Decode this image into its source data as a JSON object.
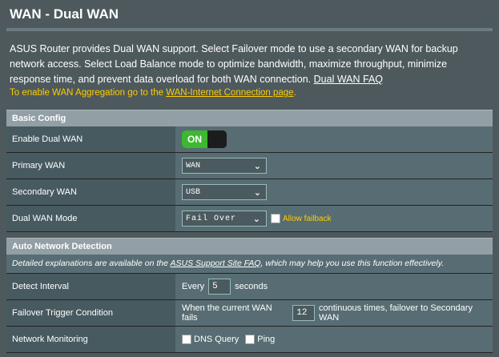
{
  "header": {
    "title": "WAN - Dual WAN",
    "description": "ASUS Router provides Dual WAN support. Select Failover mode to use a secondary WAN for backup network access. Select Load Balance mode to optimize bandwidth, maximize throughput, minimize response time, and prevent data overload for both WAN connection.",
    "faq_link": "Dual WAN FAQ",
    "aggregation_prefix": "To enable WAN Aggregation go to the ",
    "aggregation_link": "WAN-Internet Connection page",
    "aggregation_suffix": "."
  },
  "basic_config": {
    "heading": "Basic Config",
    "enable_label": "Enable Dual WAN",
    "enable_value": "ON",
    "primary_label": "Primary WAN",
    "primary_value": "WAN",
    "secondary_label": "Secondary WAN",
    "secondary_value": "USB",
    "mode_label": "Dual WAN Mode",
    "mode_value": "Fail Over",
    "allow_failback": "Allow failback"
  },
  "auto_detection": {
    "heading": "Auto Network Detection",
    "note_prefix": "Detailed explanations are available on the ",
    "note_link": "ASUS Support Site FAQ",
    "note_suffix": ", which may help you use this function effectively.",
    "interval_label": "Detect Interval",
    "interval_prefix": "Every",
    "interval_value": "5",
    "interval_suffix": "seconds",
    "failover_label": "Failover Trigger Condition",
    "failover_prefix": "When the current WAN fails",
    "failover_value": "12",
    "failover_suffix": "continuous times, failover to Secondary WAN",
    "monitoring_label": "Network Monitoring",
    "dns_query": "DNS Query",
    "ping": "Ping"
  },
  "colors": {
    "background": "#4d595d",
    "toggle_on": "#3db830",
    "accent_yellow": "#ffcc00"
  }
}
